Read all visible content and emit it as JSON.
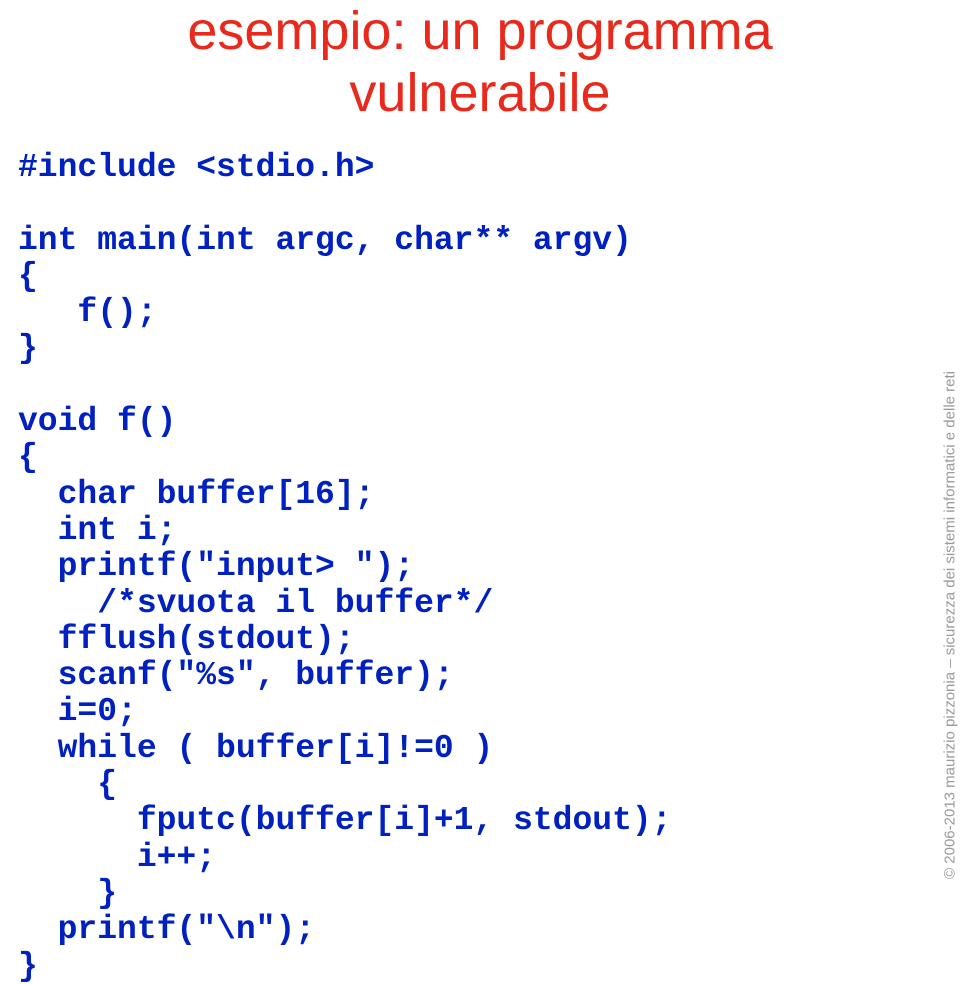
{
  "title_line1": "esempio: un programma",
  "title_line2": "vulnerabile",
  "code": {
    "l1": "#include <stdio.h>",
    "l2": "",
    "l3": "int main(int argc, char** argv)",
    "l4": "{",
    "l5": "   f();",
    "l6": "}",
    "l7": "",
    "l8": "void f()",
    "l9": "{",
    "l10": "  char buffer[16];",
    "l11": "  int i;",
    "l12": "  printf(\"input> \");",
    "l13": "    /*svuota il buffer*/",
    "l14": "  fflush(stdout);",
    "l15": "  scanf(\"%s\", buffer);",
    "l16": "  i=0;",
    "l17": "  while ( buffer[i]!=0 )",
    "l18": "    {",
    "l19": "      fputc(buffer[i]+1, stdout);",
    "l20": "      i++;",
    "l21": "    }",
    "l22": "  printf(\"\\n\");",
    "l23": "}"
  },
  "footer": "© 2006-2013 maurizio pizzonia – sicurezza dei sistemi informatici e delle reti"
}
